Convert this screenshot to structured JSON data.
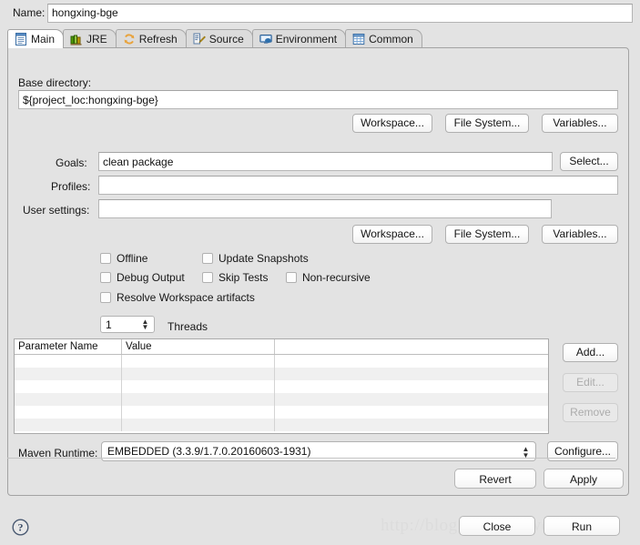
{
  "name_row": {
    "label": "Name:",
    "value": "hongxing-bge"
  },
  "tabs": [
    {
      "label": "Main",
      "icon": "document-icon",
      "selected": true
    },
    {
      "label": "JRE",
      "icon": "books-icon",
      "selected": false
    },
    {
      "label": "Refresh",
      "icon": "refresh-icon",
      "selected": false
    },
    {
      "label": "Source",
      "icon": "source-edit-icon",
      "selected": false
    },
    {
      "label": "Environment",
      "icon": "monitor-icon",
      "selected": false
    },
    {
      "label": "Common",
      "icon": "table-icon",
      "selected": false
    }
  ],
  "main": {
    "base_directory": {
      "label": "Base directory:",
      "value": "${project_loc:hongxing-bge}"
    },
    "browse_buttons_top": [
      "Workspace...",
      "File System...",
      "Variables..."
    ],
    "goals": {
      "label": "Goals:",
      "value": "clean package",
      "select_button": "Select..."
    },
    "profiles": {
      "label": "Profiles:",
      "value": ""
    },
    "user_settings": {
      "label": "User settings:",
      "value": ""
    },
    "browse_buttons_bottom": [
      "Workspace...",
      "File System...",
      "Variables..."
    ],
    "checkboxes": [
      {
        "label": "Offline",
        "checked": false
      },
      {
        "label": "Update Snapshots",
        "checked": false
      },
      {
        "label": "Debug Output",
        "checked": false
      },
      {
        "label": "Skip Tests",
        "checked": false
      },
      {
        "label": "Non-recursive",
        "checked": false
      },
      {
        "label": "Resolve Workspace artifacts",
        "checked": false
      }
    ],
    "threads": {
      "value": "1",
      "label": "Threads"
    },
    "parameters_table": {
      "columns": [
        "Parameter Name",
        "Value",
        ""
      ],
      "rows": []
    },
    "table_buttons": [
      {
        "label": "Add...",
        "enabled": true
      },
      {
        "label": "Edit...",
        "enabled": false
      },
      {
        "label": "Remove",
        "enabled": false
      }
    ],
    "maven_runtime": {
      "label": "Maven Runtime:",
      "value": "EMBEDDED (3.3.9/1.7.0.20160603-1931)",
      "configure_button": "Configure..."
    },
    "revert_button": "Revert",
    "apply_button": "Apply"
  },
  "footer": {
    "help_icon": "help-question-icon",
    "close_button": "Close",
    "run_button": "Run",
    "watermark": "http://blog.csdn.net/wdask"
  }
}
